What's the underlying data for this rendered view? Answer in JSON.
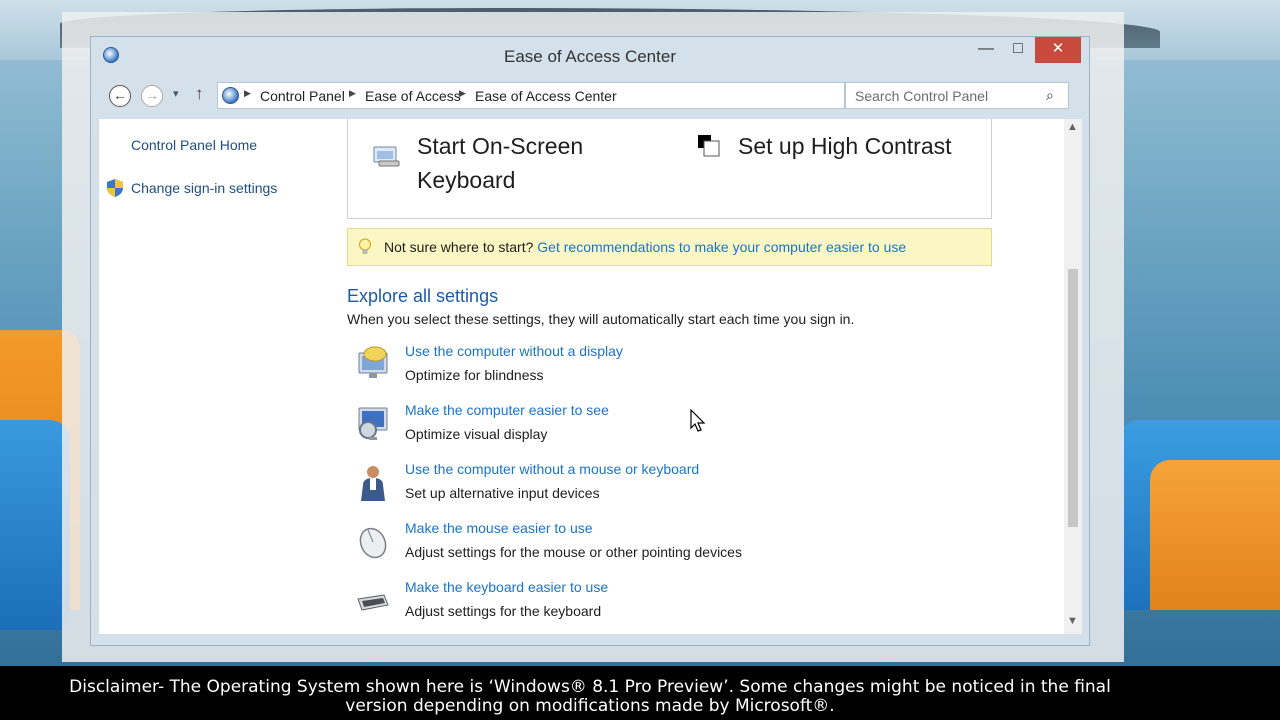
{
  "window": {
    "title": "Ease of Access Center",
    "minimize_glyph": "—",
    "maximize_glyph": "□",
    "close_glyph": "✕"
  },
  "addressbar": {
    "back_glyph": "←",
    "forward_glyph": "→",
    "history_glyph": "▾",
    "up_glyph": "↑",
    "crumbs": [
      "Control Panel",
      "Ease of Access",
      "Ease of Access Center"
    ],
    "separator_glyph": "▶",
    "dropdown_glyph": "⌄",
    "refresh_glyph": "↻",
    "search_placeholder": "Search Control Panel",
    "search_glyph": "⌕"
  },
  "sidebar": {
    "home": "Control Panel Home",
    "signin": "Change sign-in settings"
  },
  "quick_access": {
    "osk_label": "Start On-Screen Keyboard",
    "high_contrast_label": "Set up High Contrast"
  },
  "tip": {
    "prefix": "Not sure where to start?",
    "link": "Get recommendations to make your computer easier to use"
  },
  "explore": {
    "title": "Explore all settings",
    "description": "When you select these settings, they will automatically start each time you sign in.",
    "items": [
      {
        "link": "Use the computer without a display",
        "desc": "Optimize for blindness",
        "icon": "monitor-speech-icon"
      },
      {
        "link": "Make the computer easier to see",
        "desc": "Optimize visual display",
        "icon": "monitor-magnifier-icon"
      },
      {
        "link": "Use the computer without a mouse or keyboard",
        "desc": "Set up alternative input devices",
        "icon": "person-icon"
      },
      {
        "link": "Make the mouse easier to use",
        "desc": "Adjust settings for the mouse or other pointing devices",
        "icon": "mouse-icon"
      },
      {
        "link": "Make the keyboard easier to use",
        "desc": "Adjust settings for the keyboard",
        "icon": "keyboard-icon"
      }
    ]
  },
  "scrollbar": {
    "up_glyph": "▲",
    "down_glyph": "▼"
  },
  "disclaimer": "Disclaimer- The Operating System shown here is ‘Windows® 8.1 Pro Preview’. Some changes might be noticed in the final version depending on modifications made by Microsoft®.",
  "colors": {
    "link": "#1a74c8",
    "close_button": "#c74a3c",
    "tip_background": "#fbf7c4"
  }
}
